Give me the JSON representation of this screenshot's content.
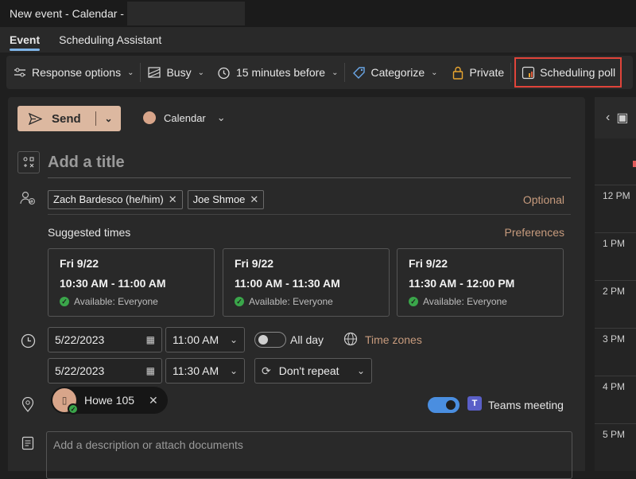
{
  "window": {
    "title": "New event - Calendar -"
  },
  "tabs": [
    {
      "label": "Event"
    },
    {
      "label": "Scheduling Assistant"
    }
  ],
  "toolbar": {
    "response_options": "Response options",
    "busy": "Busy",
    "reminder": "15 minutes before",
    "categorize": "Categorize",
    "private": "Private",
    "scheduling_poll": "Scheduling poll"
  },
  "compose": {
    "send": "Send",
    "calendar": "Calendar",
    "title_placeholder": "Add a title",
    "attendees": [
      {
        "name": "Zach Bardesco (he/him)"
      },
      {
        "name": "Joe Shmoe"
      }
    ],
    "optional": "Optional",
    "suggested_times_label": "Suggested times",
    "preferences": "Preferences",
    "suggestions": [
      {
        "date": "Fri 9/22",
        "time": "10:30 AM - 11:00 AM",
        "availability": "Available: Everyone"
      },
      {
        "date": "Fri 9/22",
        "time": "11:00 AM - 11:30 AM",
        "availability": "Available: Everyone"
      },
      {
        "date": "Fri 9/22",
        "time": "11:30 AM - 12:00 PM",
        "availability": "Available: Everyone"
      }
    ],
    "start_date": "5/22/2023",
    "start_time": "11:00 AM",
    "end_date": "5/22/2023",
    "end_time": "11:30 AM",
    "all_day": "All day",
    "time_zones": "Time zones",
    "repeat": "Don't repeat",
    "location": "Howe 105",
    "teams_meeting": "Teams meeting",
    "description_placeholder": "Add a description or attach documents"
  },
  "day_view": {
    "hours": [
      "12 PM",
      "1 PM",
      "2 PM",
      "3 PM",
      "4 PM",
      "5 PM"
    ]
  },
  "colors": {
    "accent": "#dcb8a0",
    "link": "#c79b7d",
    "highlight": "#e0443a",
    "toggle_on": "#4a8ee0",
    "available": "#3aa64a"
  }
}
